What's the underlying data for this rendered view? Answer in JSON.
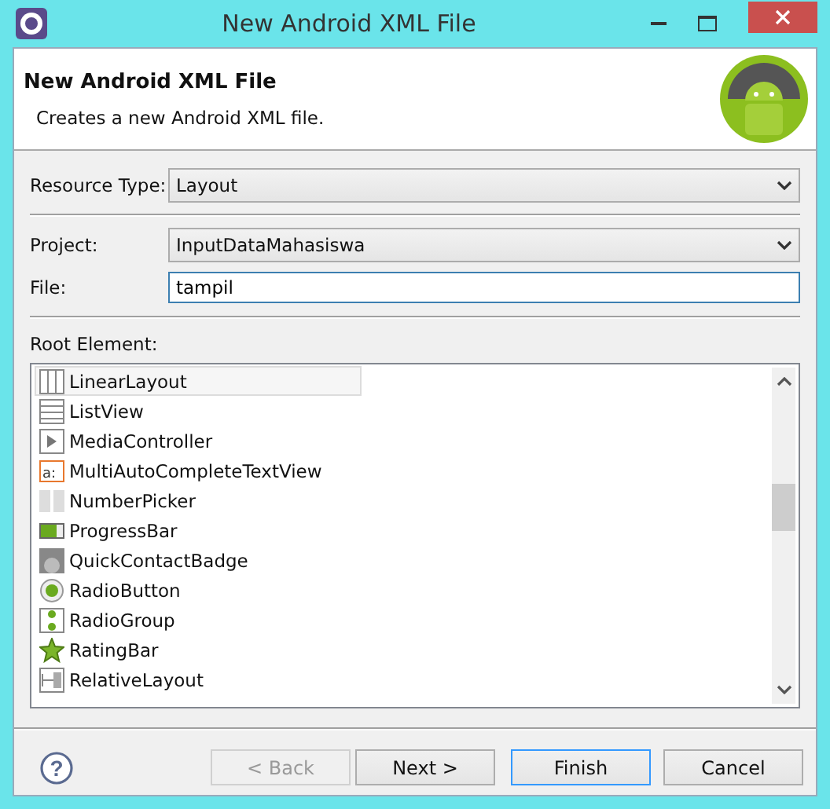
{
  "window": {
    "title": "New Android XML File"
  },
  "header": {
    "title": "New Android XML File",
    "description": "Creates a new Android XML file."
  },
  "resource_type": {
    "label": "Resource Type:",
    "value": "Layout"
  },
  "project": {
    "label": "Project:",
    "value": "InputDataMahasiswa"
  },
  "file": {
    "label": "File:",
    "value": "tampil"
  },
  "root_element": {
    "label": "Root Element:",
    "items": [
      {
        "label": "LinearLayout",
        "kind": "linear",
        "selected": true
      },
      {
        "label": "ListView",
        "kind": "list",
        "selected": false
      },
      {
        "label": "MediaController",
        "kind": "media",
        "selected": false
      },
      {
        "label": "MultiAutoCompleteTextView",
        "kind": "text",
        "icon_text": "a:",
        "selected": false
      },
      {
        "label": "NumberPicker",
        "kind": "picker",
        "selected": false
      },
      {
        "label": "ProgressBar",
        "kind": "progress",
        "selected": false
      },
      {
        "label": "QuickContactBadge",
        "kind": "badge",
        "selected": false
      },
      {
        "label": "RadioButton",
        "kind": "radio",
        "selected": false
      },
      {
        "label": "RadioGroup",
        "kind": "radiogroup",
        "selected": false
      },
      {
        "label": "RatingBar",
        "kind": "rating",
        "selected": false
      },
      {
        "label": "RelativeLayout",
        "kind": "relative",
        "selected": false
      }
    ]
  },
  "help": {
    "symbol": "?"
  },
  "buttons": [
    {
      "label": "< Back",
      "disabled": true,
      "default": false
    },
    {
      "label": "Next >",
      "disabled": false,
      "default": false
    },
    {
      "label": "Finish",
      "disabled": false,
      "default": true
    },
    {
      "label": "Cancel",
      "disabled": false,
      "default": false
    }
  ]
}
